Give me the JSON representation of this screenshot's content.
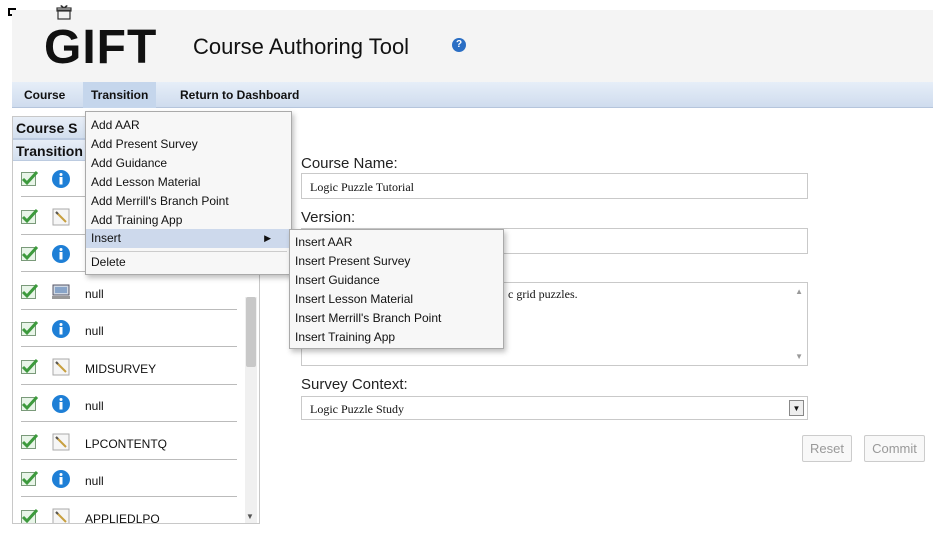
{
  "header": {
    "logo": "GIFT",
    "title": "Course Authoring Tool",
    "help_icon": "?"
  },
  "menubar": {
    "course": "Course",
    "transition": "Transition",
    "return": "Return to Dashboard"
  },
  "left_panel": {
    "header_course": "Course S",
    "header_transitions": "Transition",
    "items": [
      {
        "icon": "info-icon",
        "label": ""
      },
      {
        "icon": "survey-icon",
        "label": ""
      },
      {
        "icon": "info-icon",
        "label": ""
      },
      {
        "icon": "computer-icon",
        "label": "null"
      },
      {
        "icon": "info-icon",
        "label": "null"
      },
      {
        "icon": "survey-icon",
        "label": "MIDSURVEY"
      },
      {
        "icon": "info-icon",
        "label": "null"
      },
      {
        "icon": "survey-icon",
        "label": "LPCONTENTQ"
      },
      {
        "icon": "info-icon",
        "label": "null"
      },
      {
        "icon": "survey-icon",
        "label": "APPLIEDLPQ"
      }
    ]
  },
  "form": {
    "course_name_label": "Course Name:",
    "course_name_value": "Logic Puzzle Tutorial",
    "version_label": "Version:",
    "description_partial": "c grid puzzles.",
    "survey_context_label": "Survey Context:",
    "survey_context_value": "Logic Puzzle Study",
    "reset": "Reset",
    "commit": "Commit"
  },
  "transition_menu": {
    "items": [
      "Add AAR",
      "Add Present Survey",
      "Add Guidance",
      "Add Lesson Material",
      "Add Merrill's Branch Point",
      "Add Training App",
      "Insert",
      "Delete"
    ]
  },
  "insert_submenu": {
    "items": [
      "Insert AAR",
      "Insert Present Survey",
      "Insert Guidance",
      "Insert Lesson Material",
      "Insert Merrill's Branch Point",
      "Insert Training App"
    ]
  },
  "colors": {
    "check": "#4caf50",
    "info": "#1e7fd6",
    "menubar": "#d6e2f1",
    "highlight": "#cdd9ec"
  }
}
